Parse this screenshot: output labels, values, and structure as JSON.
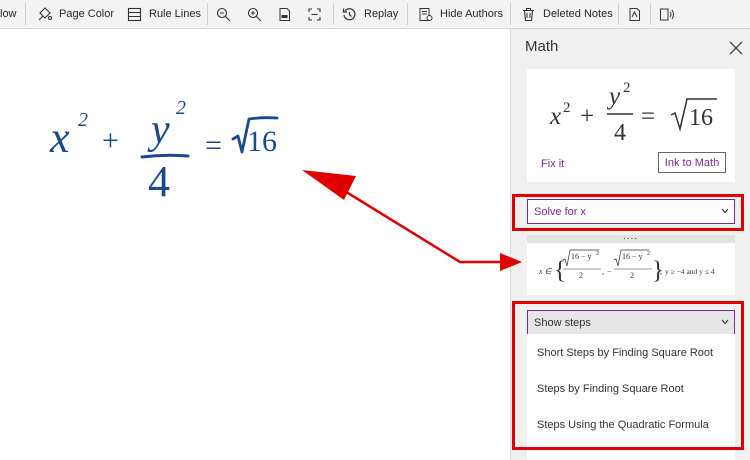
{
  "toolbar": {
    "view_partial_label": "low",
    "page_color_label": "Page Color",
    "rule_lines_label": "Rule Lines",
    "replay_label": "Replay",
    "hide_authors_label": "Hide Authors",
    "deleted_notes_label": "Deleted Notes"
  },
  "math_pane": {
    "title": "Math",
    "fix_it_label": "Fix it",
    "ink_to_math_label": "Ink to Math",
    "solve_select": {
      "selected": "Solve for x"
    },
    "result": {
      "x_in": "x ∈",
      "root_expr": "16 − y",
      "exp2": "2",
      "den": "2",
      "minus": "−",
      "comma": ",",
      "condition": "y ≥ −4 and y ≤ 4"
    },
    "steps_select": {
      "selected": "Show steps"
    },
    "steps_options": [
      "Short Steps by Finding Square Root",
      "Steps by Finding Square Root",
      "Steps Using the Quadratic Formula"
    ]
  },
  "equation": {
    "x": "x",
    "y": "y",
    "exp": "2",
    "plus": "+",
    "den": "4",
    "equals": "=",
    "radicand": "16"
  },
  "colors": {
    "ink": "#1a4a8c",
    "accent": "#7a2a8f",
    "highlight": "#e00000"
  }
}
